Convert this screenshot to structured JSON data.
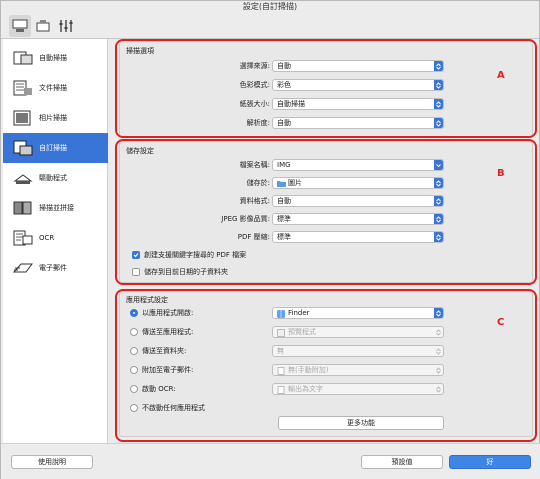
{
  "window": {
    "title": "設定(自訂掃描)"
  },
  "toolbar": {
    "items": [
      {
        "icon": "scan-from-computer-icon",
        "active": true
      },
      {
        "icon": "scan-from-operation-panel-icon",
        "active": false
      },
      {
        "icon": "general-settings-icon",
        "active": false
      }
    ]
  },
  "sidebar": {
    "items": [
      {
        "label": "自動掃描",
        "icon": "auto-scan-icon"
      },
      {
        "label": "文件掃描",
        "icon": "document-scan-icon"
      },
      {
        "label": "相片掃描",
        "icon": "photo-scan-icon"
      },
      {
        "label": "自訂掃描",
        "icon": "custom-scan-icon",
        "selected": true
      },
      {
        "label": "驅動程式",
        "icon": "driver-icon"
      },
      {
        "label": "掃描並拼接",
        "icon": "scan-stitch-icon"
      },
      {
        "label": "OCR",
        "icon": "ocr-icon"
      },
      {
        "label": "電子郵件",
        "icon": "email-icon"
      }
    ]
  },
  "scan_options": {
    "title": "掃描選項",
    "fields": [
      {
        "label": "選擇來源:",
        "value": "自動"
      },
      {
        "label": "色彩模式:",
        "value": "彩色"
      },
      {
        "label": "紙張大小:",
        "value": "自動掃描"
      },
      {
        "label": "解析度:",
        "value": "自動"
      }
    ]
  },
  "save_settings": {
    "title": "儲存設定",
    "fields": [
      {
        "label": "檔案名稱:",
        "value": "IMG"
      },
      {
        "label": "儲存於:",
        "value": "圖片"
      },
      {
        "label": "資料格式:",
        "value": "自動"
      },
      {
        "label": "JPEG 影像品質:",
        "value": "標準"
      },
      {
        "label": "PDF 壓縮:",
        "value": "標準"
      }
    ],
    "checkboxes": [
      {
        "label": "創建支援關鍵字搜尋的 PDF 檔案",
        "checked": true
      },
      {
        "label": "儲存到目前日期的子資料夾",
        "checked": false
      }
    ]
  },
  "app_settings": {
    "title": "應用程式設定",
    "options": [
      {
        "label": "以應用程式開啟:",
        "value": "Finder",
        "selected": true,
        "enabled": true
      },
      {
        "label": "傳送至應用程式:",
        "value": "預覽程式",
        "selected": false,
        "enabled": false
      },
      {
        "label": "傳送至資料夾:",
        "value": "無",
        "selected": false,
        "enabled": false
      },
      {
        "label": "附加至電子郵件:",
        "value": "無(手動附加)",
        "selected": false,
        "enabled": false
      },
      {
        "label": "啟動 OCR:",
        "value": "輸出為文字",
        "selected": false,
        "enabled": false
      },
      {
        "label": "不啟動任何應用程式",
        "selected": false
      }
    ],
    "more_button": "更多功能"
  },
  "callouts": {
    "a": "A",
    "b": "B",
    "c": "C"
  },
  "footer": {
    "help_button": "使用說明",
    "defaults_button": "預設值",
    "ok_button": "好"
  },
  "colors": {
    "accent": "#3875d7",
    "callout": "#e02020"
  }
}
